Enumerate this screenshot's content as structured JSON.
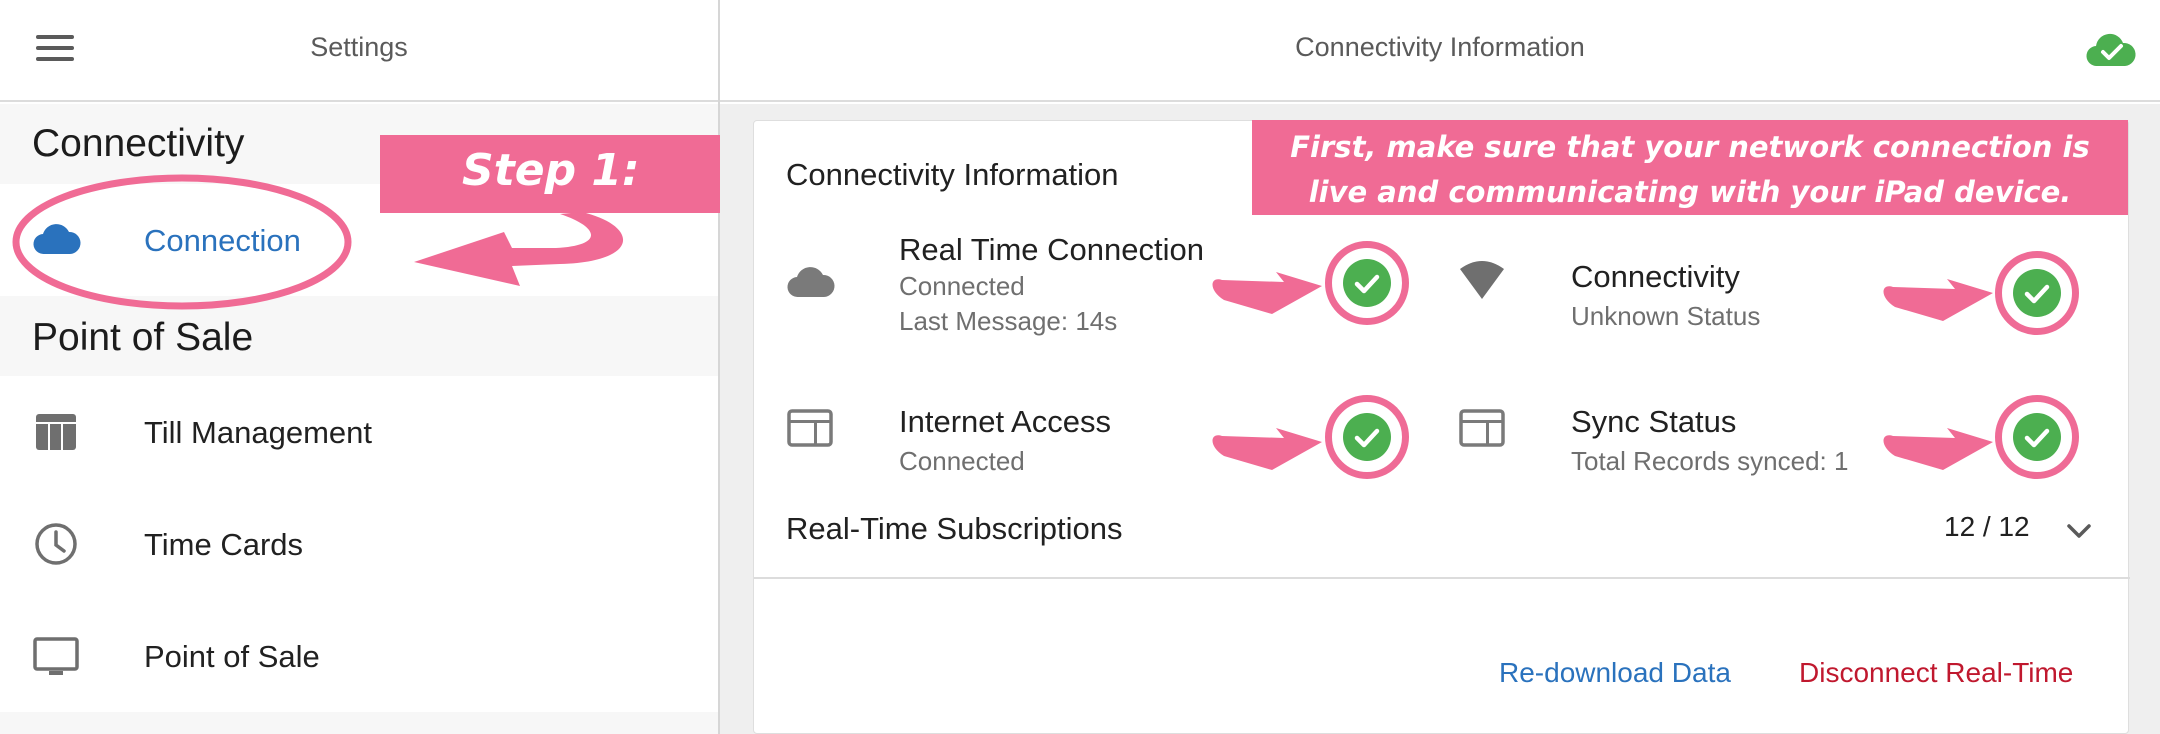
{
  "sidebar": {
    "title": "Settings",
    "sections": [
      {
        "heading": "Connectivity",
        "items": [
          {
            "label": "Connection",
            "icon": "cloud-icon",
            "active": true
          }
        ]
      },
      {
        "heading": "Point of Sale",
        "items": [
          {
            "label": "Till Management",
            "icon": "till-icon"
          },
          {
            "label": "Time Cards",
            "icon": "clock-icon"
          },
          {
            "label": "Point of Sale",
            "icon": "monitor-icon"
          }
        ]
      }
    ]
  },
  "main": {
    "title": "Connectivity Information",
    "card_title": "Connectivity Information",
    "stats": [
      {
        "title": "Real Time Connection",
        "subtitle": "Connected",
        "subtitle2": "Last Message:   14s",
        "icon": "cloud-icon",
        "status": "ok"
      },
      {
        "title": "Connectivity",
        "subtitle": "Unknown Status",
        "icon": "wifi-icon",
        "status": "ok"
      },
      {
        "title": "Internet Access",
        "subtitle": "Connected",
        "icon": "web-icon",
        "status": "ok"
      },
      {
        "title": "Sync Status",
        "subtitle": "Total Records synced: 1",
        "icon": "web-icon",
        "status": "ok"
      }
    ],
    "subscriptions": {
      "label": "Real-Time Subscriptions",
      "count": "12 / 12"
    },
    "actions": {
      "redownload": "Re-download Data",
      "disconnect": "Disconnect Real-Time"
    }
  },
  "annotations": {
    "step": "Step 1:",
    "note_line1": "First, make sure that your network connection is",
    "note_line2": "live and communicating with your iPad device."
  },
  "colors": {
    "accent": "#2a72bd",
    "danger": "#c0182e",
    "success": "#4caf50",
    "annotation": "#f06b95"
  }
}
